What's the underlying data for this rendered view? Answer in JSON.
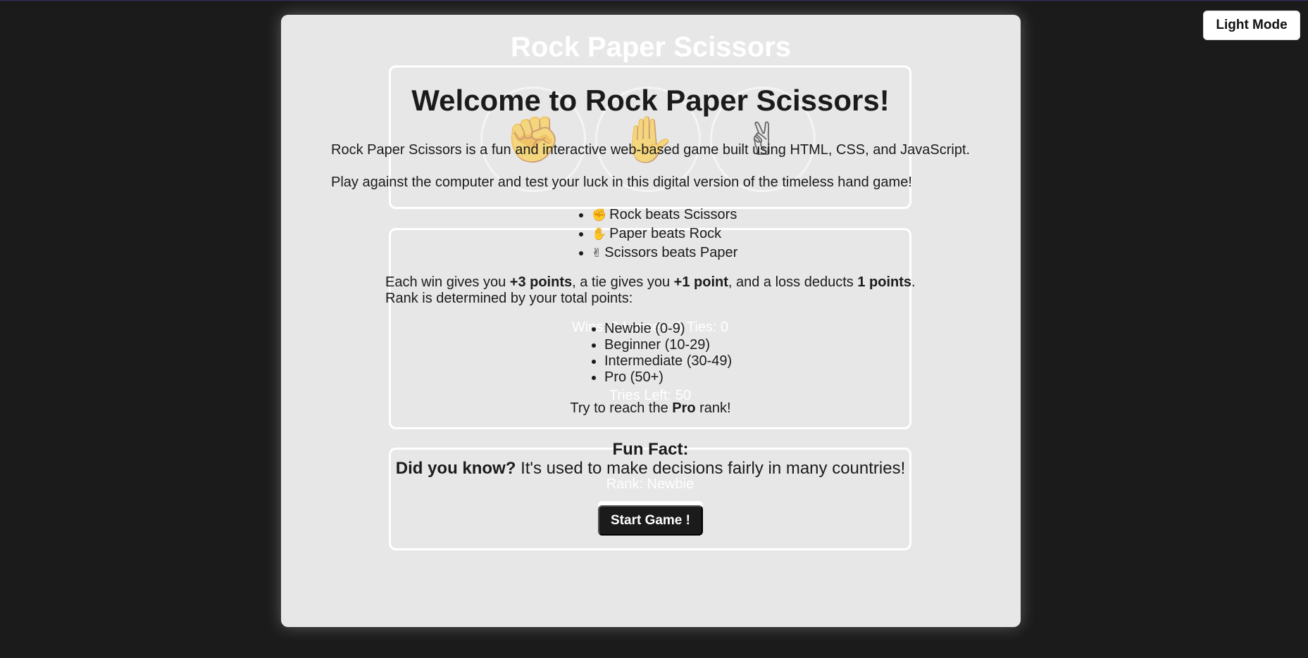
{
  "theme_toggle": {
    "label": "Light Mode"
  },
  "game": {
    "title": "Rock Paper Scissors",
    "choices": [
      {
        "name": "rock",
        "glyph": "✊"
      },
      {
        "name": "paper",
        "glyph": "✋"
      },
      {
        "name": "scissors",
        "glyph": "✌"
      }
    ],
    "score_line": "Wins: 0  Losses: 0  Ties: 0",
    "tries_left": "Tries Left: 50",
    "rank": "Rank: Newbie"
  },
  "welcome": {
    "title": "Welcome to Rock Paper Scissors!",
    "intro_1": "Rock Paper Scissors is a fun and interactive web-based game built using HTML, CSS, and JavaScript.",
    "intro_2": "Play against the computer and test your luck in this digital version of the timeless hand game!",
    "rules": [
      {
        "emoji": "✊",
        "text": "Rock beats Scissors"
      },
      {
        "emoji": "✋",
        "text": "Paper beats Rock"
      },
      {
        "emoji": "✌",
        "text": "Scissors beats Paper"
      }
    ],
    "scoring": {
      "p1": "Each win gives you ",
      "win_pts": "+3 points",
      "p2": ", a tie gives you ",
      "tie_pts": "+1 point",
      "p3": ", and a loss deducts ",
      "loss_pts": "1 points",
      "p4": ".",
      "line2": "Rank is determined by your total points:"
    },
    "ranks": [
      "Newbie (0-9)",
      "Beginner (10-29)",
      "Intermediate (30-49)",
      "Pro (50+)"
    ],
    "reach": {
      "pre": "Try to reach the ",
      "bold": "Pro",
      "post": " rank!"
    },
    "fun_fact": {
      "title": "Fun Fact:",
      "lead": "Did you know?",
      "text": " It's used to make decisions fairly in many countries!"
    },
    "start_button": "Start Game !"
  }
}
